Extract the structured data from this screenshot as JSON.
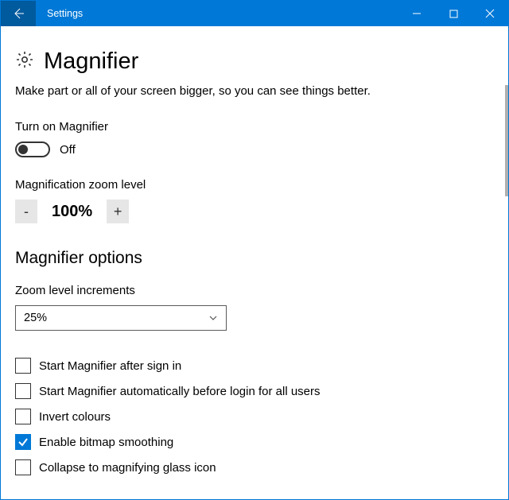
{
  "titlebar": {
    "title": "Settings"
  },
  "page": {
    "heading": "Magnifier",
    "subtitle": "Make part or all of your screen bigger, so you can see things better."
  },
  "toggle": {
    "label": "Turn on Magnifier",
    "state_text": "Off",
    "on": false
  },
  "zoom": {
    "label": "Magnification zoom level",
    "minus": "-",
    "value": "100%",
    "plus": "+"
  },
  "options": {
    "heading": "Magnifier options",
    "increments_label": "Zoom level increments",
    "increments_value": "25%",
    "checkboxes": [
      {
        "label": "Start Magnifier after sign in",
        "checked": false
      },
      {
        "label": "Start Magnifier automatically before login for all users",
        "checked": false
      },
      {
        "label": "Invert colours",
        "checked": false
      },
      {
        "label": "Enable bitmap smoothing",
        "checked": true
      },
      {
        "label": "Collapse to magnifying glass icon",
        "checked": false
      }
    ]
  }
}
